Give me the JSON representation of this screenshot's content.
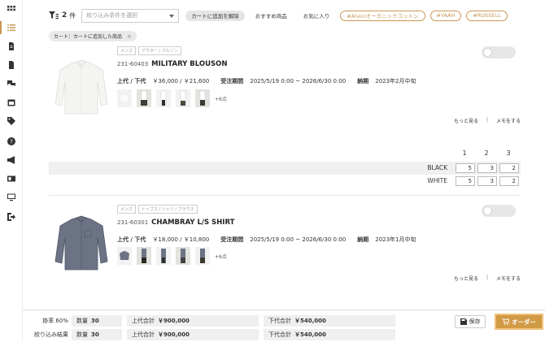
{
  "topbar": {
    "count": "2",
    "count_unit": "件",
    "select_placeholder": "絞り込み条件を選択",
    "filter_pills": [
      {
        "label": "カートに追加を解除"
      },
      {
        "label": "おすすめ商品"
      },
      {
        "label": "お気に入り"
      }
    ],
    "tag_pills": [
      {
        "label": "#Alviniオーガニックコットン"
      },
      {
        "label": "#YAAH"
      },
      {
        "label": "#RUSSELL"
      }
    ]
  },
  "active_chip": {
    "label": "カート：カートに追加した商品",
    "close": "×"
  },
  "products": [
    {
      "badges": [
        "メンズ",
        "アウター / ブルゾン"
      ],
      "code": "231-60403",
      "name": "MILITARY BLOUSON",
      "price_label": "上代 / 下代",
      "price_value": "￥36,000 / ￥21,600",
      "period_label": "受注期間",
      "period_value": "2025/5/19 0:00 ~ 2026/6/30 0:00",
      "delivery_label": "納期",
      "delivery_value": "2023年2月中旬",
      "more_count": "+6点",
      "link_more": "もっと見る",
      "link_sep": "|",
      "link_memo": "メモをする"
    },
    {
      "badges": [
        "メンズ",
        "トップス / シャツ / ブラウス"
      ],
      "code": "231-60301",
      "name": "CHAMBRAY L/S SHIRT",
      "price_label": "上代 / 下代",
      "price_value": "￥18,000 / ￥10,800",
      "period_label": "受注期間",
      "period_value": "2025/5/19 0:00 ~ 2026/6/30 0:00",
      "delivery_label": "納期",
      "delivery_value": "2023年1月中旬",
      "more_count": "+6点",
      "link_more": "もっと見る",
      "link_sep": "|",
      "link_memo": "メモをする"
    }
  ],
  "size_grid": {
    "sizes": [
      "1",
      "2",
      "3"
    ],
    "rows": [
      {
        "color": "BLACK",
        "qty": [
          "5",
          "3",
          "2"
        ]
      },
      {
        "color": "WHITE",
        "qty": [
          "5",
          "3",
          "2"
        ]
      }
    ]
  },
  "summary": {
    "rows": [
      {
        "label": "掛率 60%",
        "qty_label": "数量",
        "qty": "30",
        "upper_label": "上代合計",
        "upper": "￥900,000",
        "lower_label": "下代合計",
        "lower": "￥540,000"
      },
      {
        "label": "絞り込み結果",
        "qty_label": "数量",
        "qty": "30",
        "upper_label": "上代合計",
        "upper": "￥900,000",
        "lower_label": "下代合計",
        "lower": "￥540,000"
      }
    ],
    "save_label": "保存",
    "order_label": "オーダー"
  },
  "colors": {
    "accent": "#c99752",
    "order_button": "#d19a45"
  }
}
